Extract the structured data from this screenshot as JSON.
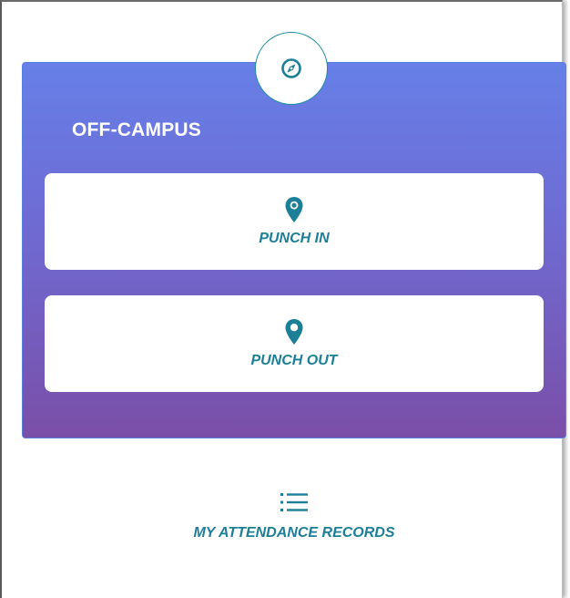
{
  "card": {
    "title": "OFF-CAMPUS"
  },
  "buttons": {
    "punch_in": "PUNCH IN",
    "punch_out": "PUNCH OUT"
  },
  "records": {
    "label": "MY ATTENDANCE RECORDS"
  },
  "icons": {
    "badge": "compass-icon",
    "punch_in": "map-pin-icon",
    "punch_out": "map-pin-icon",
    "records": "list-icon"
  },
  "colors": {
    "accent": "#1b7f98",
    "card_gradient_top": "#6680e8",
    "card_gradient_bottom": "#7a4fa8"
  }
}
